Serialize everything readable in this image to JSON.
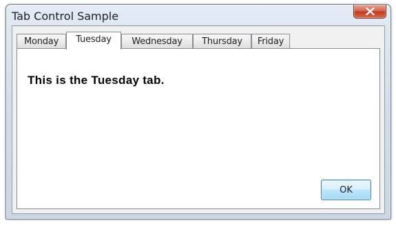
{
  "window": {
    "title": "Tab Control Sample",
    "close_icon": "close-icon"
  },
  "tabs": [
    {
      "label": "Monday",
      "selected": false
    },
    {
      "label": "Tuesday",
      "selected": true
    },
    {
      "label": "Wednesday",
      "selected": false
    },
    {
      "label": "Thursday",
      "selected": false
    },
    {
      "label": "Friday",
      "selected": false
    }
  ],
  "panel": {
    "text": "This is the Tuesday tab."
  },
  "buttons": {
    "ok_label": "OK"
  },
  "colors": {
    "close_button": "#c2381f",
    "ok_button": "#bee6fd",
    "panel_background": "#ffffff"
  }
}
